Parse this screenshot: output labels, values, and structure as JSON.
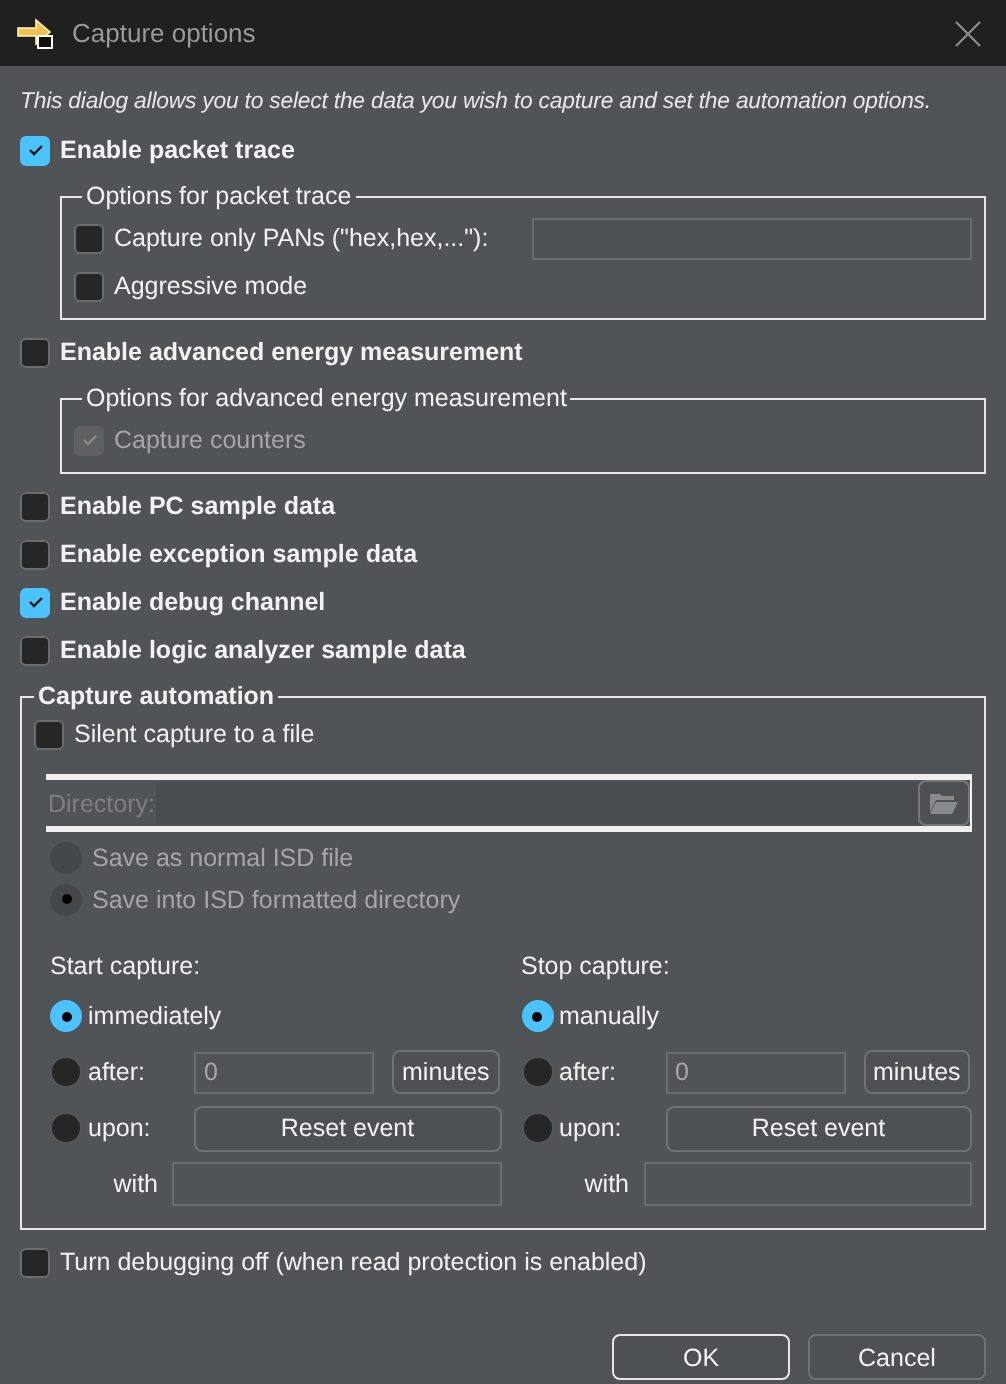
{
  "window": {
    "title": "Capture options"
  },
  "intro": "This dialog allows you to select the data you wish to capture and set the automation options.",
  "items": [
    {
      "kind": "check",
      "label": "Enable packet trace",
      "checked": true
    },
    {
      "kind": "group",
      "title": "Options for packet trace",
      "options": [
        {
          "kind": "field",
          "label": "Capture only PANs (\"hex,hex,...\"):",
          "checked": false,
          "disabled": false
        },
        {
          "kind": "plain",
          "label": "Aggressive mode",
          "checked": false,
          "disabled": false
        }
      ]
    },
    {
      "kind": "check",
      "label": "Enable advanced energy measurement",
      "checked": false
    },
    {
      "kind": "group",
      "title": "Options for advanced energy measurement",
      "options": [
        {
          "kind": "plain",
          "label": "Capture counters",
          "checked": true,
          "disabled": true
        }
      ]
    },
    {
      "kind": "check",
      "label": "Enable PC sample data",
      "checked": false
    },
    {
      "kind": "check",
      "label": "Enable exception sample data",
      "checked": false
    },
    {
      "kind": "check",
      "label": "Enable debug channel",
      "checked": true
    },
    {
      "kind": "check",
      "label": "Enable logic analyzer sample data",
      "checked": false
    }
  ],
  "automation": {
    "title": "Capture automation",
    "silent": {
      "label": "Silent capture to a file",
      "checked": false
    },
    "directory_label": "Directory:",
    "save_modes": [
      {
        "label": "Save as normal ISD file",
        "selected": false
      },
      {
        "label": "Save into ISD formatted directory",
        "selected": true
      }
    ],
    "columns": [
      {
        "title": "Start capture:",
        "options": [
          {
            "kind": "plain",
            "label": "immediately",
            "selected": true
          },
          {
            "kind": "after",
            "label": "after:",
            "value": "0",
            "unit": "minutes",
            "selected": false
          },
          {
            "kind": "upon",
            "label": "upon:",
            "button": "Reset event",
            "selected": false
          }
        ],
        "with_label": "with"
      },
      {
        "title": "Stop capture:",
        "options": [
          {
            "kind": "plain",
            "label": "manually",
            "selected": true
          },
          {
            "kind": "after",
            "label": "after:",
            "value": "0",
            "unit": "minutes",
            "selected": false
          },
          {
            "kind": "upon",
            "label": "upon:",
            "button": "Reset event",
            "selected": false
          }
        ],
        "with_label": "with"
      }
    ]
  },
  "footer_check": {
    "label": "Turn debugging off (when read protection is enabled)",
    "checked": false
  },
  "buttons": [
    {
      "label": "OK",
      "default": true
    },
    {
      "label": "Cancel",
      "default": false
    }
  ]
}
